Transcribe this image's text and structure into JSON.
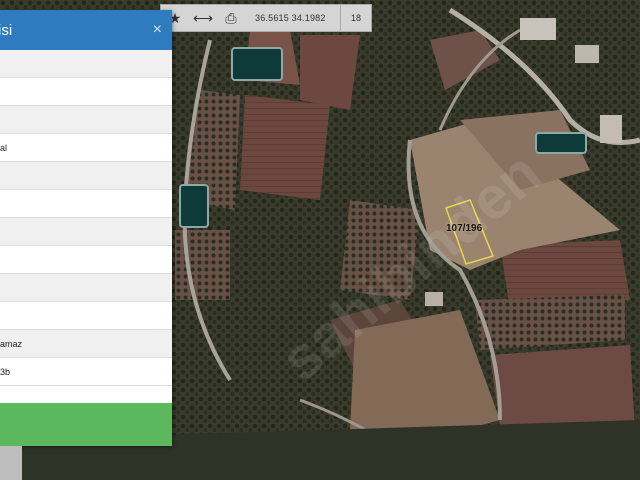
{
  "toolbar": {
    "coords": "36.5615   34.1982",
    "zoom": "18",
    "icons": [
      "star-icon",
      "measure-icon",
      "print-icon"
    ]
  },
  "panel": {
    "title": "isi",
    "close": "×",
    "rows": [
      "",
      "",
      "",
      "al",
      "",
      "",
      "",
      "",
      "",
      "",
      "amaz",
      "3b"
    ]
  },
  "map": {
    "parcel_label": "107/196",
    "parcel_outline_color": "#e6d84a",
    "watermark": "sahibinden"
  },
  "colors": {
    "header": "#2f7bbf",
    "action": "#5cb85c"
  }
}
